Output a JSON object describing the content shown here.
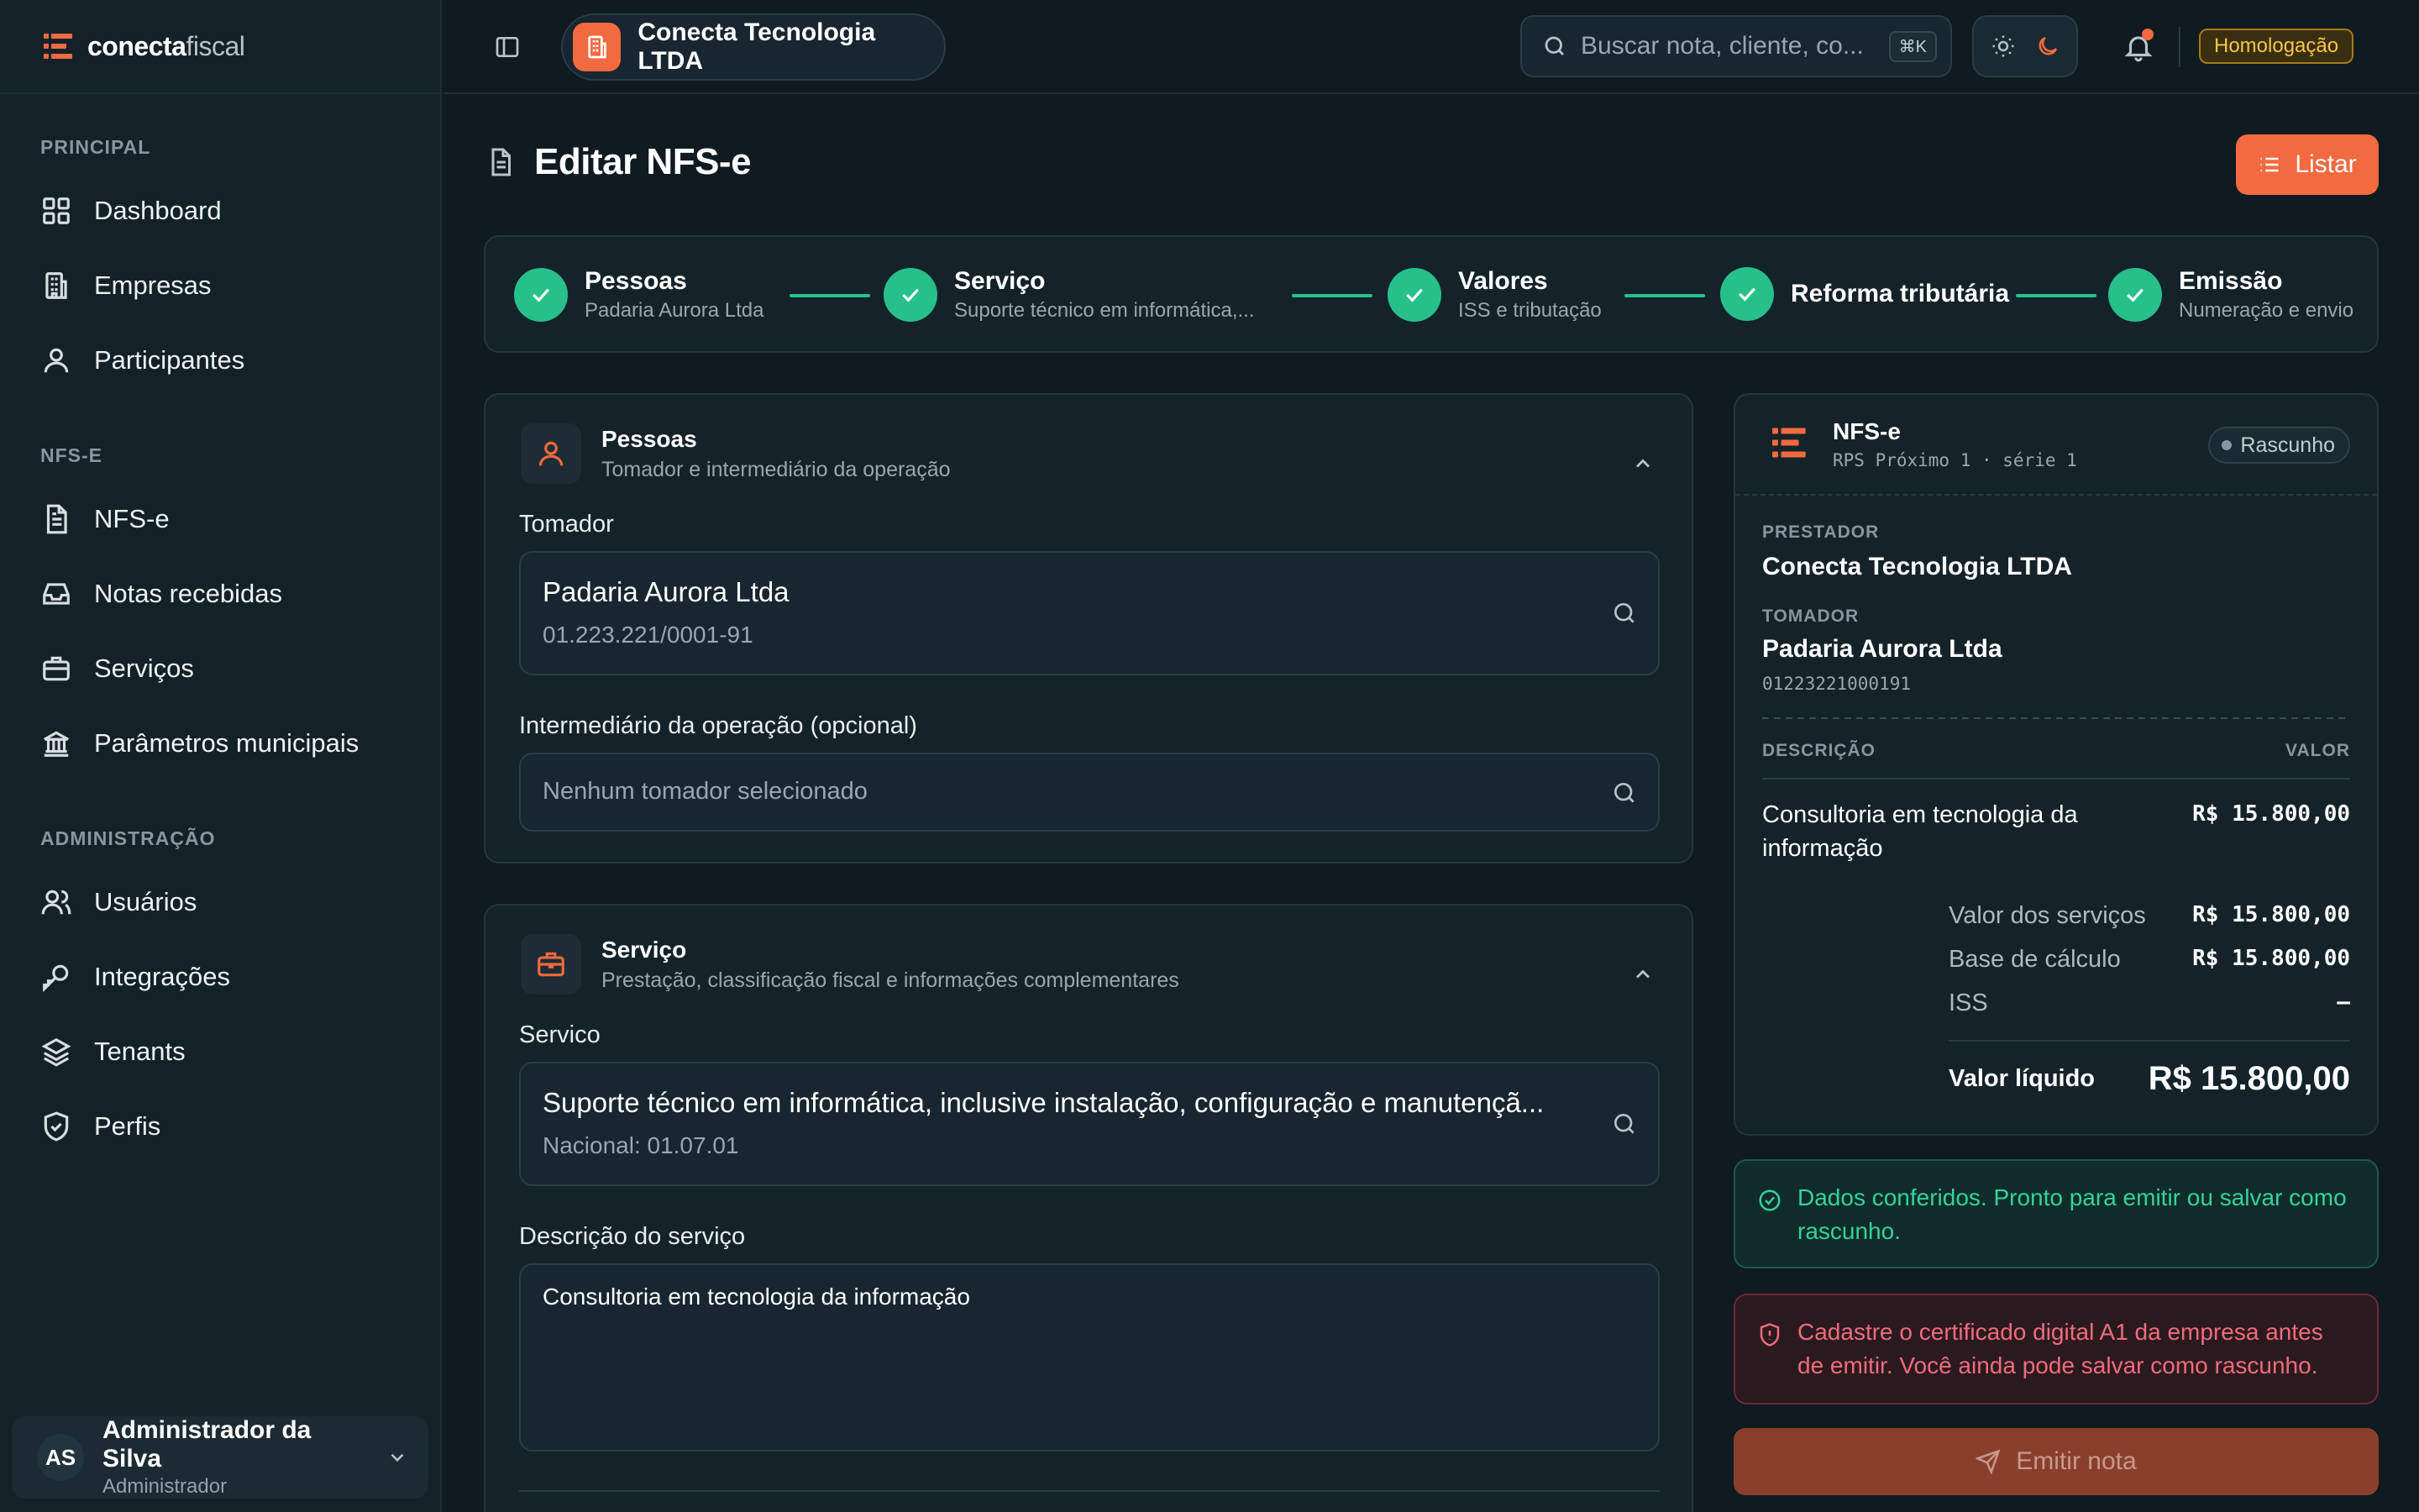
{
  "brand": {
    "name_bold": "conecta",
    "name_light": "fiscal"
  },
  "sidebar": {
    "sections": [
      {
        "title": "PRINCIPAL",
        "items": [
          {
            "label": "Dashboard",
            "icon": "grid-icon"
          },
          {
            "label": "Empresas",
            "icon": "building-icon"
          },
          {
            "label": "Participantes",
            "icon": "user-icon"
          }
        ]
      },
      {
        "title": "NFS-E",
        "items": [
          {
            "label": "NFS-e",
            "icon": "document-icon"
          },
          {
            "label": "Notas recebidas",
            "icon": "inbox-icon"
          },
          {
            "label": "Serviços",
            "icon": "briefcase-icon"
          },
          {
            "label": "Parâmetros municipais",
            "icon": "bank-icon"
          }
        ]
      },
      {
        "title": "ADMINISTRAÇÃO",
        "items": [
          {
            "label": "Usuários",
            "icon": "users-icon"
          },
          {
            "label": "Integrações",
            "icon": "key-icon"
          },
          {
            "label": "Tenants",
            "icon": "layers-icon"
          },
          {
            "label": "Perfis",
            "icon": "shield-icon"
          }
        ]
      }
    ],
    "user": {
      "initials": "AS",
      "name": "Administrador da Silva",
      "role": "Administrador"
    }
  },
  "topbar": {
    "company": "Conecta Tecnologia LTDA",
    "search_placeholder": "Buscar nota, cliente, co...",
    "search_shortcut": "⌘K",
    "environment": "Homologação"
  },
  "page": {
    "title": "Editar NFS-e",
    "list_button": "Listar"
  },
  "stepper": [
    {
      "title": "Pessoas",
      "sub": "Padaria Aurora Ltda"
    },
    {
      "title": "Serviço",
      "sub": "Suporte técnico em informática,..."
    },
    {
      "title": "Valores",
      "sub": "ISS e tributação"
    },
    {
      "title": "Reforma tributária",
      "sub": ""
    },
    {
      "title": "Emissão",
      "sub": "Numeração e envio"
    }
  ],
  "pessoas": {
    "title": "Pessoas",
    "subtitle": "Tomador e intermediário da operação",
    "tomador_label": "Tomador",
    "tomador_name": "Padaria Aurora Ltda",
    "tomador_doc": "01.223.221/0001-91",
    "intermediario_label": "Intermediário da operação (opcional)",
    "intermediario_placeholder": "Nenhum tomador selecionado"
  },
  "servico": {
    "title": "Serviço",
    "subtitle": "Prestação, classificação fiscal e informações complementares",
    "servico_label": "Servico",
    "servico_name": "Suporte técnico em informática, inclusive instalação, configuração e manutençã...",
    "servico_code": "Nacional: 01.07.01",
    "descricao_label": "Descrição do serviço",
    "descricao_value": "Consultoria em tecnologia da informação"
  },
  "summary": {
    "title": "NFS-e",
    "rps": "RPS Próximo 1 · série 1",
    "status": "Rascunho",
    "prestador_label": "PRESTADOR",
    "prestador": "Conecta Tecnologia LTDA",
    "tomador_label": "TOMADOR",
    "tomador": "Padaria Aurora Ltda",
    "tomador_doc": "01223221000191",
    "col_descricao": "DESCRIÇÃO",
    "col_valor": "VALOR",
    "item_desc_line1": "Consultoria em tecnologia da",
    "item_desc_line2": "informação",
    "item_value": "R$ 15.800,00",
    "valor_servicos_label": "Valor dos serviços",
    "valor_servicos": "R$ 15.800,00",
    "base_calculo_label": "Base de cálculo",
    "base_calculo": "R$ 15.800,00",
    "iss_label": "ISS",
    "iss": "—",
    "valor_liquido_label": "Valor líquido",
    "valor_liquido": "R$ 15.800,00"
  },
  "alerts": {
    "ok": "Dados conferidos. Pronto para emitir ou salvar como rascunho.",
    "error": "Cadastre o certificado digital A1 da empresa antes de emitir. Você ainda pode salvar como rascunho."
  },
  "emit_button": "Emitir nota",
  "colors": {
    "accent": "#f26a3f",
    "success": "#27c08a",
    "danger": "#f16b7a",
    "background": "#0f1a21"
  }
}
